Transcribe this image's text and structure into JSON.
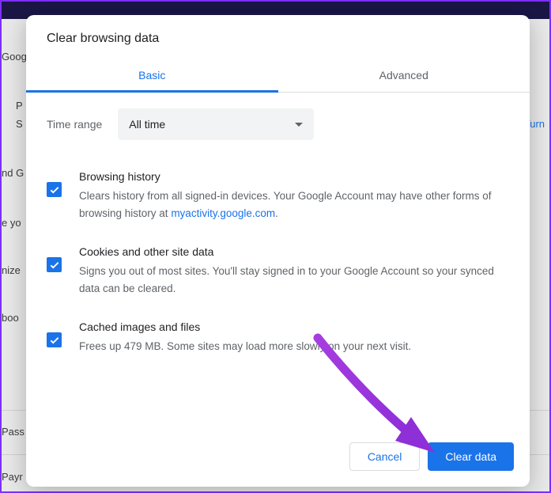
{
  "dialog": {
    "title": "Clear browsing data",
    "tabs": {
      "basic": "Basic",
      "advanced": "Advanced"
    },
    "time_range": {
      "label": "Time range",
      "value": "All time"
    },
    "options": [
      {
        "title": "Browsing history",
        "desc_before": "Clears history from all signed-in devices. Your Google Account may have other forms of browsing history at ",
        "link_text": "myactivity.google.com",
        "desc_after": "."
      },
      {
        "title": "Cookies and other site data",
        "desc": "Signs you out of most sites. You'll stay signed in to your Google Account so your synced data can be cleared."
      },
      {
        "title": "Cached images and files",
        "desc": "Frees up 479 MB. Some sites may load more slowly on your next visit."
      }
    ],
    "buttons": {
      "cancel": "Cancel",
      "clear": "Clear data"
    }
  },
  "background": {
    "goog": "Goog",
    "p": "P",
    "s": "S",
    "turn": "Turn",
    "nd_g": "nd G",
    "e_yo": "e yo",
    "nize": "nize",
    "boo": "boo",
    "pass": "Pass",
    "payr": "Payr"
  }
}
